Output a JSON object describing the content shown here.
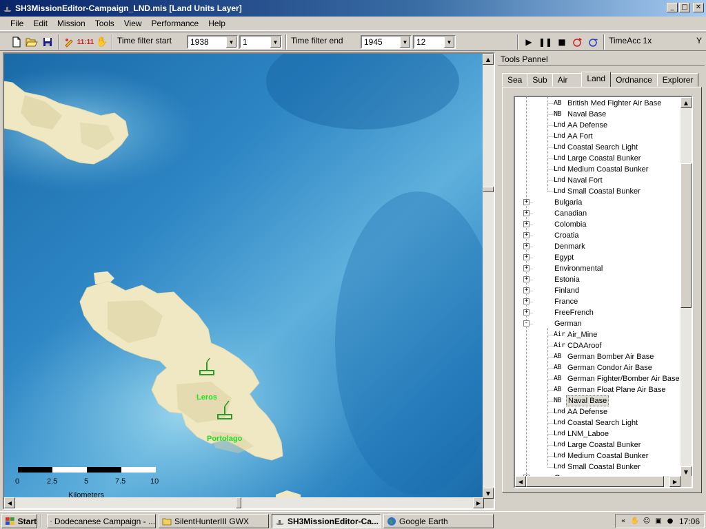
{
  "window": {
    "title": "SH3MissionEditor-Campaign_LND.mis [Land Units Layer]",
    "min_icon": "minimize-icon",
    "max_icon": "maximize-icon",
    "close_icon": "close-icon"
  },
  "menu": [
    "File",
    "Edit",
    "Mission",
    "Tools",
    "View",
    "Performance",
    "Help"
  ],
  "toolbar": {
    "time_filter_start_label": "Time filter start",
    "start_year": "1938",
    "start_month": "1",
    "time_filter_end_label": "Time filter end",
    "end_year": "1945",
    "end_month": "12",
    "clock_label": "11:11",
    "timeacc_label": "TimeAcc 1x",
    "corner_label": "Y"
  },
  "map": {
    "labels": [
      {
        "text": "Leros",
        "color": "#22dd22"
      },
      {
        "text": "Portolago",
        "color": "#22dd22"
      }
    ],
    "scale": {
      "ticks": [
        "0",
        "2.5",
        "5",
        "7.5",
        "10"
      ],
      "unit": "Kilometers"
    },
    "colors": {
      "sea_deep": "#1e78b8",
      "sea_shallow": "#8ac8e8",
      "land": "#f2ecc8",
      "marker": "#2a9a2a"
    }
  },
  "tools_panel": {
    "header": "Tools Pannel",
    "tabs": [
      "Sea",
      "Sub",
      "Air",
      "Land",
      "Ordnance",
      "Explorer"
    ],
    "active_tab": "Land",
    "tree": [
      {
        "type": "AB",
        "name": "British Med Fighter Air Base",
        "level": 2
      },
      {
        "type": "NB",
        "name": "Naval Base",
        "level": 2
      },
      {
        "type": "Lnd",
        "name": "AA Defense",
        "level": 2
      },
      {
        "type": "Lnd",
        "name": "AA Fort",
        "level": 2
      },
      {
        "type": "Lnd",
        "name": "Coastal Search Light",
        "level": 2
      },
      {
        "type": "Lnd",
        "name": "Large Coastal Bunker",
        "level": 2
      },
      {
        "type": "Lnd",
        "name": "Medium Coastal Bunker",
        "level": 2
      },
      {
        "type": "Lnd",
        "name": "Naval Fort",
        "level": 2
      },
      {
        "type": "Lnd",
        "name": "Small Coastal Bunker",
        "level": 2
      },
      {
        "type": "",
        "name": "Bulgaria",
        "level": 1,
        "expander": "+"
      },
      {
        "type": "",
        "name": "Canadian",
        "level": 1,
        "expander": "+"
      },
      {
        "type": "",
        "name": "Colombia",
        "level": 1,
        "expander": "+"
      },
      {
        "type": "",
        "name": "Croatia",
        "level": 1,
        "expander": "+"
      },
      {
        "type": "",
        "name": "Denmark",
        "level": 1,
        "expander": "+"
      },
      {
        "type": "",
        "name": "Egypt",
        "level": 1,
        "expander": "+"
      },
      {
        "type": "",
        "name": "Environmental",
        "level": 1,
        "expander": "+"
      },
      {
        "type": "",
        "name": "Estonia",
        "level": 1,
        "expander": "+"
      },
      {
        "type": "",
        "name": "Finland",
        "level": 1,
        "expander": "+"
      },
      {
        "type": "",
        "name": "France",
        "level": 1,
        "expander": "+"
      },
      {
        "type": "",
        "name": "FreeFrench",
        "level": 1,
        "expander": "+"
      },
      {
        "type": "",
        "name": "German",
        "level": 1,
        "expander": "-"
      },
      {
        "type": "Air",
        "name": "Air_Mine",
        "level": 2
      },
      {
        "type": "Air",
        "name": "CDAAroof",
        "level": 2
      },
      {
        "type": "AB",
        "name": "German Bomber Air Base",
        "level": 2
      },
      {
        "type": "AB",
        "name": "German Condor Air Base",
        "level": 2
      },
      {
        "type": "AB",
        "name": "German Fighter/Bomber Air Base",
        "level": 2
      },
      {
        "type": "AB",
        "name": "German Float Plane Air Base",
        "level": 2
      },
      {
        "type": "NB",
        "name": "Naval Base",
        "level": 2,
        "selected": true
      },
      {
        "type": "Lnd",
        "name": "AA Defense",
        "level": 2
      },
      {
        "type": "Lnd",
        "name": "Coastal Search Light",
        "level": 2
      },
      {
        "type": "Lnd",
        "name": "LNM_Laboe",
        "level": 2
      },
      {
        "type": "Lnd",
        "name": "Large Coastal Bunker",
        "level": 2
      },
      {
        "type": "Lnd",
        "name": "Medium Coastal Bunker",
        "level": 2
      },
      {
        "type": "Lnd",
        "name": "Small Coastal Bunker",
        "level": 2
      },
      {
        "type": "",
        "name": "Greece",
        "level": 1,
        "expander": "+"
      }
    ]
  },
  "taskbar": {
    "start": "Start",
    "tasks": [
      {
        "label": "Dodecanese Campaign - ...",
        "icon": "firefox-icon"
      },
      {
        "label": "SilentHunterIII GWX",
        "icon": "folder-icon"
      },
      {
        "label": "SH3MissionEditor-Ca...",
        "icon": "editor-icon",
        "active": true
      },
      {
        "label": "Google Earth",
        "icon": "globe-icon"
      }
    ],
    "clock": "17:06"
  }
}
